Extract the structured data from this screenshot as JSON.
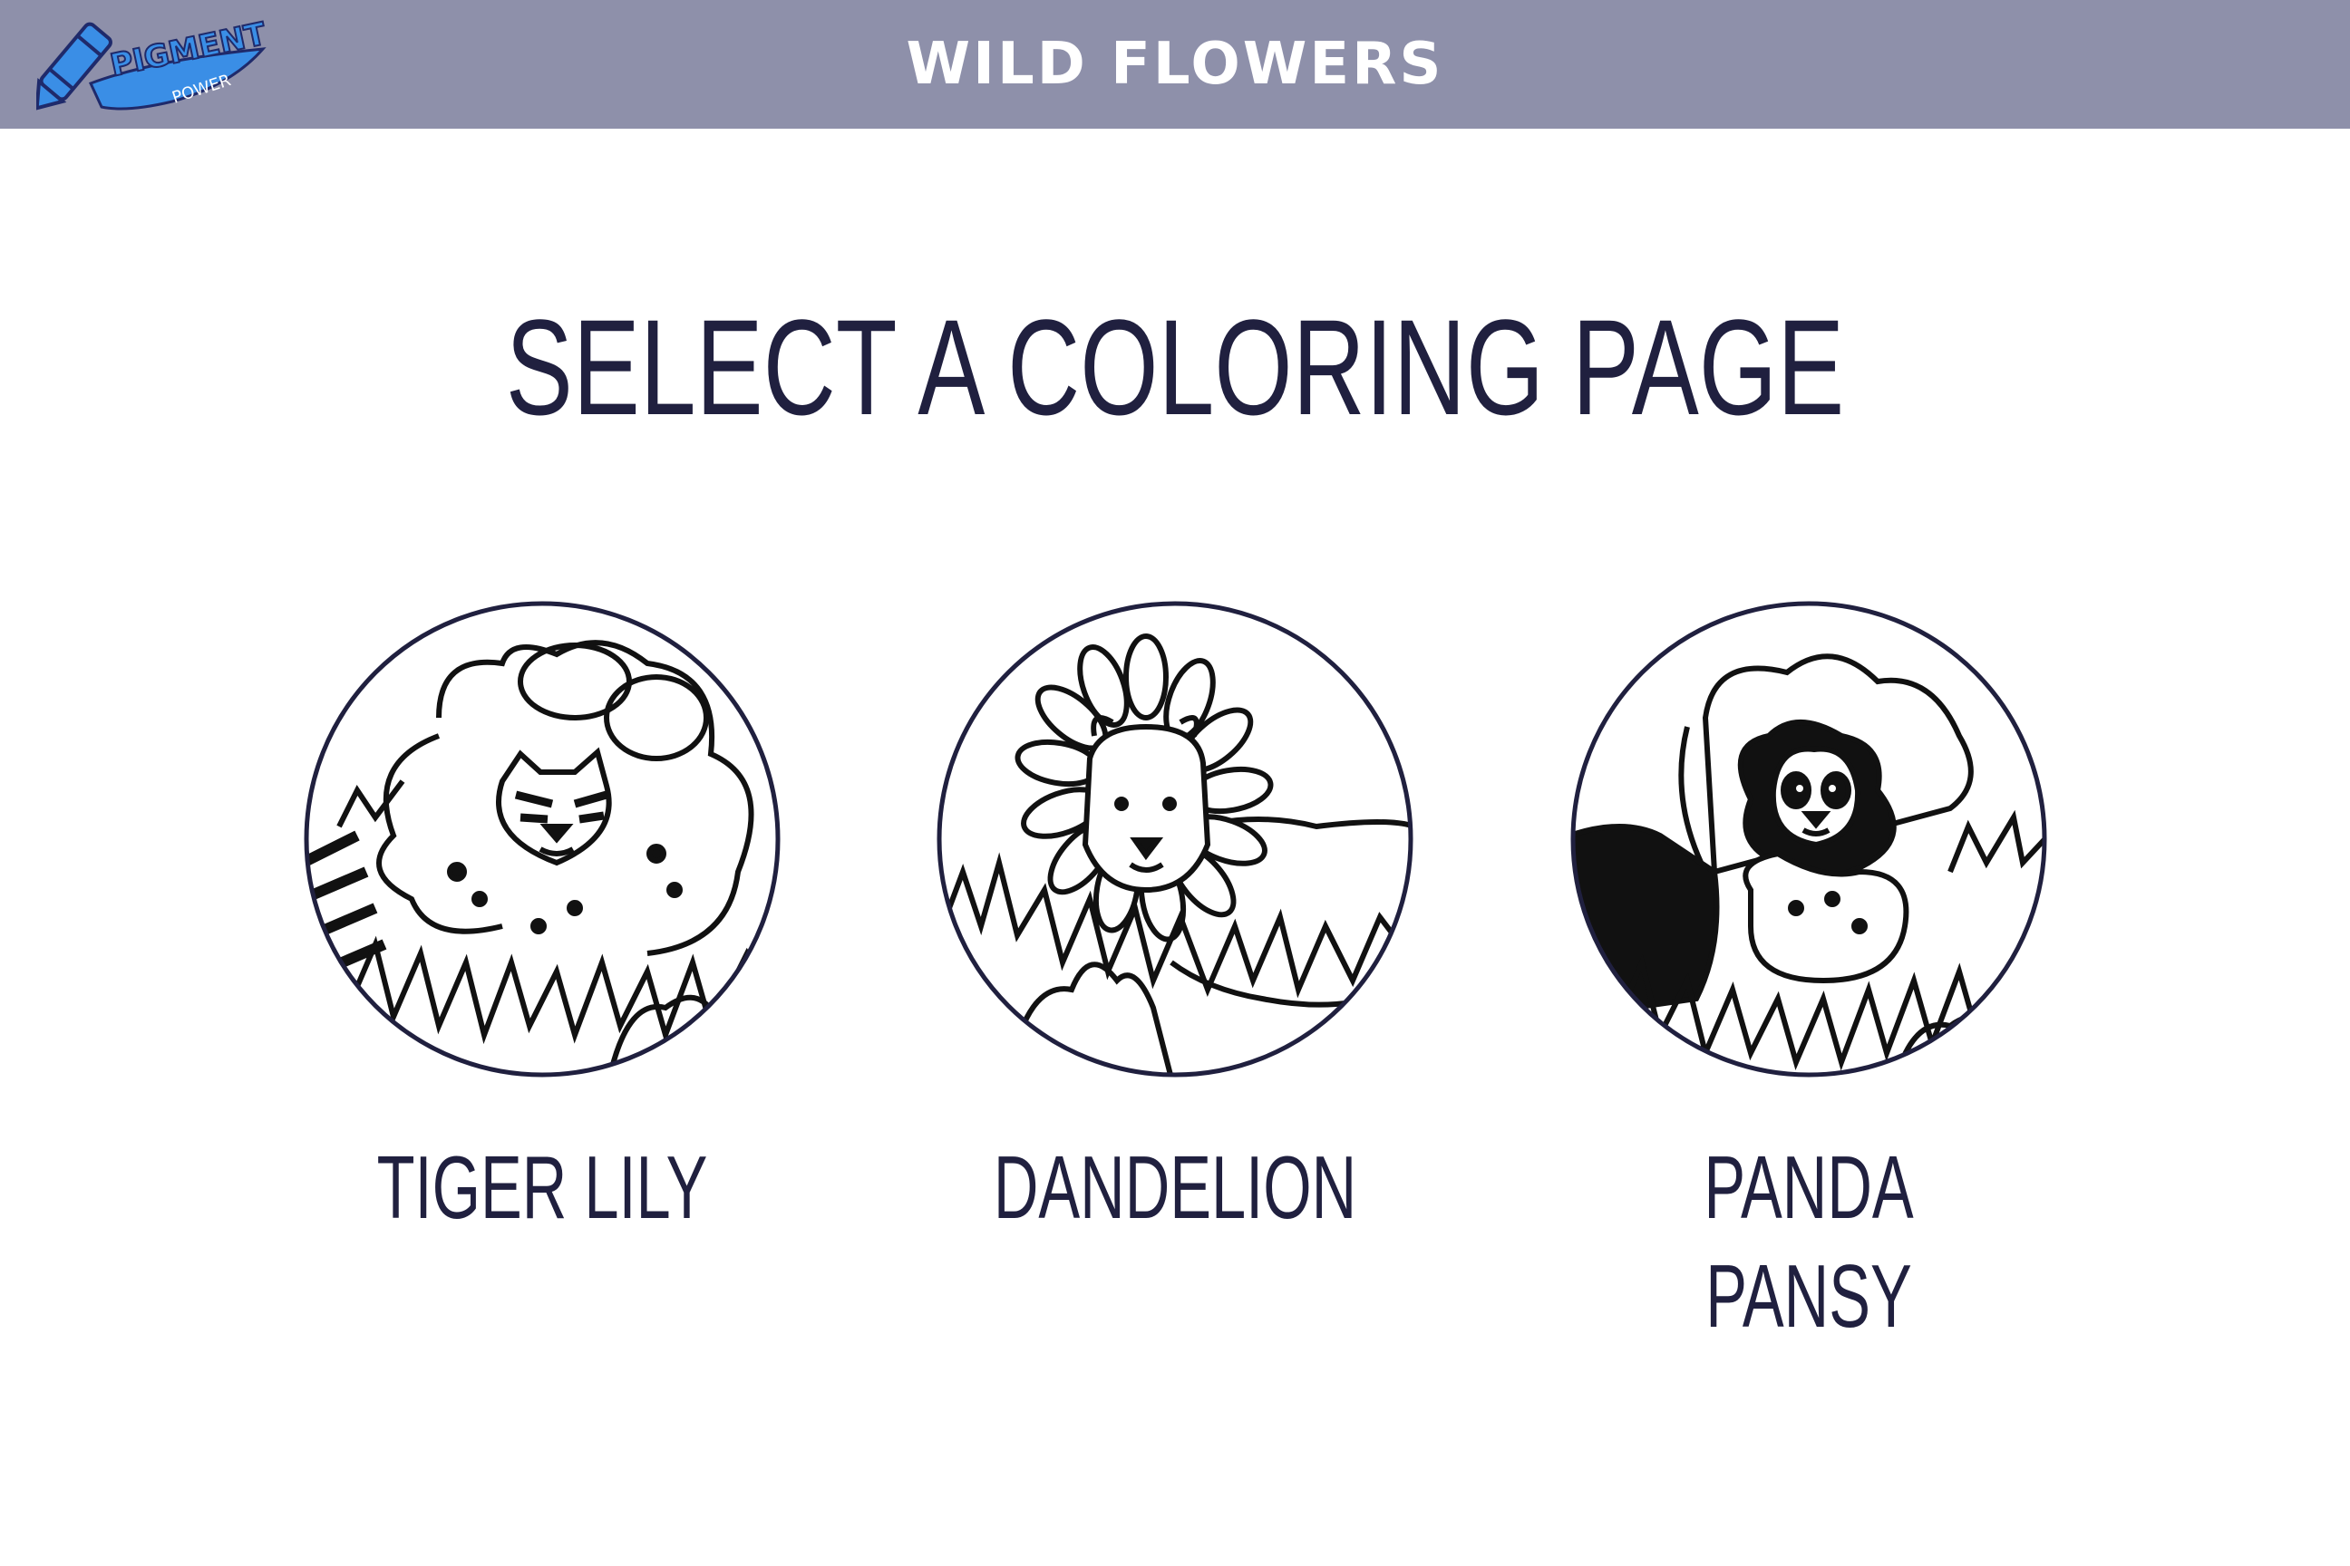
{
  "header": {
    "app_title": "WILD FLOWERS",
    "logo_text_top": "PIGMENT",
    "logo_text_bottom": "POWER"
  },
  "main": {
    "heading": "SELECT A COLORING PAGE",
    "pages": [
      {
        "label": "TIGER LILY",
        "animal_icon": "tiger-icon"
      },
      {
        "label": "DANDELION",
        "animal_icon": "lion-icon"
      },
      {
        "label": "PANDA PANSY",
        "animal_icon": "panda-icon"
      }
    ]
  },
  "colors": {
    "header_bg": "#8e90aa",
    "text": "#20203f",
    "logo_blue": "#3a8ee6",
    "background": "#ffffff"
  }
}
